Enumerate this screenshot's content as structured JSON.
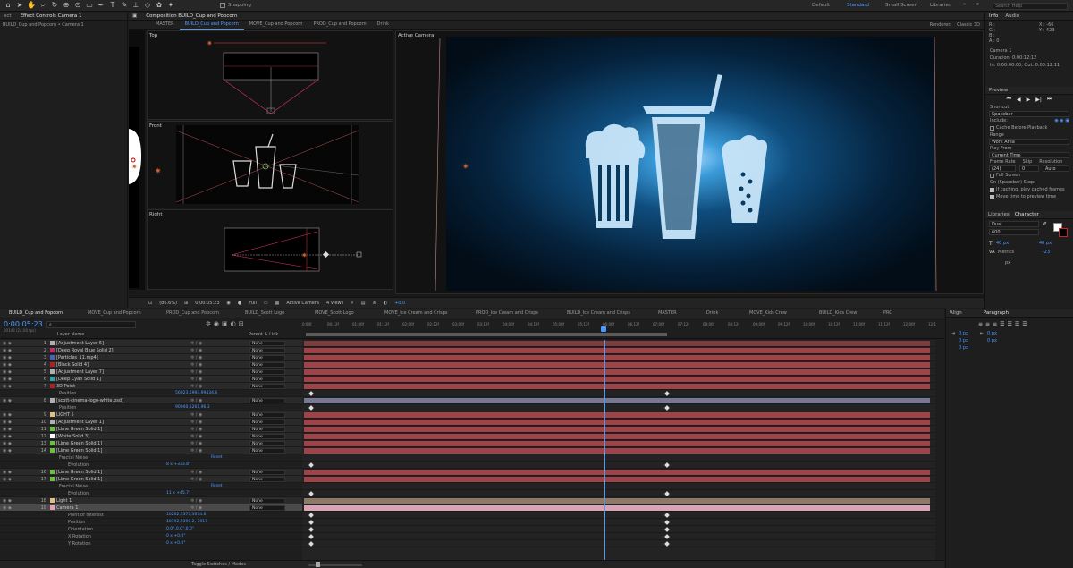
{
  "toolbar": {
    "snapping_label": "Snapping",
    "workspaces": [
      "Default",
      "Standard",
      "Small Screen",
      "Libraries"
    ],
    "search_placeholder": "Search Help"
  },
  "left_panel": {
    "tab_label": "Effect Controls Camera 1",
    "breadcrumb": "BUILD_Cup and Popcorn • Camera 1"
  },
  "comp_panel": {
    "title": "Composition BUILD_Cup and Popcorn",
    "tabs": [
      "MASTER",
      "BUILD_Cup and Popcorn",
      "MOVE_Cup and Popcorn",
      "PROD_Cup and Popcorn",
      "Drink"
    ],
    "renderer": "Renderer:",
    "renderer_value": "Classic 3D",
    "view_labels": [
      "Top",
      "Front",
      "Right",
      "Active Camera"
    ]
  },
  "viewer_footer": {
    "zoom": "(86.6%)",
    "timecode": "0:00:05:23",
    "resolution": "Full",
    "camera": "Active Camera",
    "views": "4 Views",
    "exposure": "+0.0"
  },
  "info": {
    "tabs": [
      "Info",
      "Audio"
    ],
    "rgba": [
      "R :",
      "G :",
      "B :",
      "A : 0"
    ],
    "coords": [
      "X : -66",
      "Y : 423"
    ],
    "camera_name": "Camera 1",
    "duration": "Duration: 0:00:12:12",
    "range": "In: 0:00:00:00, Out: 0:00:12:11"
  },
  "preview": {
    "title": "Preview",
    "shortcut_label": "Shortcut",
    "shortcut_value": "Spacebar",
    "include_label": "Include:",
    "cache_label": "Cache Before Playback",
    "range_label": "Range",
    "range_value": "Work Area",
    "play_from_label": "Play From",
    "play_from_value": "Current Time",
    "frame_rate_label": "Frame Rate",
    "skip_label": "Skip",
    "resolution_label": "Resolution",
    "frame_rate_value": "(24)",
    "skip_value": "0",
    "resolution_value": "Auto",
    "full_screen_label": "Full Screen",
    "stop_label": "On (Spacebar) Stop:",
    "stop_opt1": "If caching, play cached frames",
    "stop_opt2": "Move time to preview time"
  },
  "character": {
    "tabs": [
      "Libraries",
      "Character"
    ],
    "font": "Dual",
    "style": "600",
    "size": "40 px",
    "leading": "40 px",
    "tracking": "-23",
    "kerning": "Metrics",
    "unit": "px"
  },
  "paragraph": {
    "tabs": [
      "Align",
      "Paragraph"
    ],
    "indents": [
      "0 px",
      "0 px",
      "0 px"
    ],
    "spacing": [
      "0 px",
      "0 px"
    ]
  },
  "timeline": {
    "tabs": [
      "BUILD_Cup and Popcorn",
      "MOVE_Cup and Popcorn",
      "PROD_Cup and Popcorn",
      "BUILD_Scott Logo",
      "MOVE_Scott Logo",
      "MOVE_Ice Cream and Crisps",
      "PROD_Ice Cream and Crisps",
      "BUILD_Ice Cream and Crisps",
      "MASTER",
      "Drink",
      "MOVE_Kids Crew",
      "BUILD_Kids Crew",
      "PRC"
    ],
    "timecode": "0:00:05:23",
    "frame_info": "00143 (24.00 fps)",
    "col_layer": "Layer Name",
    "col_parent": "Parent & Link",
    "ruler": [
      "0:00f",
      "00:12f",
      "01:00f",
      "01:12f",
      "02:00f",
      "02:12f",
      "03:00f",
      "03:12f",
      "04:00f",
      "04:12f",
      "05:00f",
      "05:12f",
      "06:00f",
      "06:12f",
      "07:00f",
      "07:12f",
      "08:00f",
      "08:12f",
      "09:00f",
      "09:12f",
      "10:00f",
      "10:12f",
      "11:00f",
      "11:12f",
      "12:00f",
      "12:1"
    ],
    "footer": "Toggle Switches / Modes",
    "rows": [
      {
        "n": "1",
        "name": "[Adjustment Layer 6]",
        "kind": "layer",
        "sw": "#b0b0b0",
        "parent": "None",
        "bar": "#7d3c3e",
        "ind": 0
      },
      {
        "n": "2",
        "name": "[Deep Royal Blue Solid 2]",
        "kind": "layer",
        "sw": "#c42a6a",
        "parent": "None",
        "bar": "#9e4448",
        "ind": 0
      },
      {
        "n": "3",
        "name": "[Particles_11.mp4]",
        "kind": "layer",
        "sw": "#4a5fbf",
        "parent": "None",
        "bar": "#9e4448",
        "ind": 0
      },
      {
        "n": "4",
        "name": "[Black Solid 4]",
        "kind": "layer",
        "sw": "#b02020",
        "parent": "None",
        "bar": "#9e4448",
        "ind": 0
      },
      {
        "n": "5",
        "name": "[Adjustment Layer 7]",
        "kind": "layer",
        "sw": "#b0b0b0",
        "parent": "None",
        "bar": "#9e4448",
        "ind": 0
      },
      {
        "n": "6",
        "name": "[Deep Cyan Solid 1]",
        "kind": "layer",
        "sw": "#2aa4a8",
        "parent": "None",
        "bar": "#9e4448",
        "ind": 0
      },
      {
        "n": "7",
        "name": "3D Point",
        "kind": "layer",
        "sw": "#b02020",
        "parent": "None",
        "bar": "#9e4448",
        "ind": 0
      },
      {
        "n": "",
        "name": "Position",
        "kind": "prop",
        "value": "56023,5993,99434.6",
        "ind": 1
      },
      {
        "n": "8",
        "name": "[scott-cinema-logo-white.psd]",
        "kind": "layer",
        "sw": "#b0b0b0",
        "parent": "None",
        "bar": "#787896",
        "ind": 0
      },
      {
        "n": "",
        "name": "Position",
        "kind": "prop",
        "value": "90040,5261,96.3",
        "ind": 1
      },
      {
        "n": "9",
        "name": "LIGHT 5",
        "kind": "layer",
        "sw": "#e0c080",
        "parent": "None",
        "bar": "#9e4448",
        "ind": 0
      },
      {
        "n": "10",
        "name": "[Adjustment Layer 1]",
        "kind": "layer",
        "sw": "#b0b0b0",
        "parent": "None",
        "bar": "#9e4448",
        "ind": 0
      },
      {
        "n": "11",
        "name": "[Lime Green Solid 1]",
        "kind": "layer",
        "sw": "#6cc040",
        "parent": "None",
        "bar": "#9e4448",
        "ind": 0
      },
      {
        "n": "12",
        "name": "[White Solid 3]",
        "kind": "layer",
        "sw": "#ffffff",
        "parent": "None",
        "bar": "#9e4448",
        "ind": 0
      },
      {
        "n": "13",
        "name": "[Lime Green Solid 1]",
        "kind": "layer",
        "sw": "#6cc040",
        "parent": "None",
        "bar": "#9e4448",
        "ind": 0
      },
      {
        "n": "14",
        "name": "[Lime Green Solid 1]",
        "kind": "layer",
        "sw": "#6cc040",
        "parent": "None",
        "bar": "#9e4448",
        "ind": 0
      },
      {
        "n": "",
        "name": "Fractal Noise",
        "kind": "effect",
        "value": "Reset",
        "ind": 1
      },
      {
        "n": "",
        "name": "Evolution",
        "kind": "prop",
        "value": "8 x +333.8°",
        "ind": 2
      },
      {
        "n": "16",
        "name": "[Lime Green Solid 1]",
        "kind": "layer",
        "sw": "#6cc040",
        "parent": "None",
        "bar": "#9e4448",
        "ind": 0
      },
      {
        "n": "17",
        "name": "[Lime Green Solid 1]",
        "kind": "layer",
        "sw": "#6cc040",
        "parent": "None",
        "bar": "#9e4448",
        "ind": 0
      },
      {
        "n": "",
        "name": "Fractal Noise",
        "kind": "effect",
        "value": "Reset",
        "ind": 1
      },
      {
        "n": "",
        "name": "Evolution",
        "kind": "prop",
        "value": "11 x +45.7°",
        "ind": 2
      },
      {
        "n": "18",
        "name": "Light 1",
        "kind": "layer",
        "sw": "#e0c080",
        "parent": "None",
        "bar": "#8c7a66",
        "ind": 0
      },
      {
        "n": "19",
        "name": "Camera 1",
        "kind": "layer",
        "sw": "#e8a0b8",
        "parent": "None",
        "bar": "#d9a3b3",
        "ind": 0,
        "sel": true
      },
      {
        "n": "",
        "name": "Point of Interest",
        "kind": "prop",
        "value": "10202,5373,1074.6",
        "ind": 2
      },
      {
        "n": "",
        "name": "Position",
        "kind": "prop",
        "value": "10192,5390.2,-7917",
        "ind": 2
      },
      {
        "n": "",
        "name": "Orientation",
        "kind": "prop",
        "value": "0.0°,0.0°,0.0°",
        "ind": 2
      },
      {
        "n": "",
        "name": "X Rotation",
        "kind": "prop",
        "value": "0 x +0.0°",
        "ind": 2
      },
      {
        "n": "",
        "name": "Y Rotation",
        "kind": "prop",
        "value": "0 x +0.0°",
        "ind": 2
      }
    ]
  }
}
